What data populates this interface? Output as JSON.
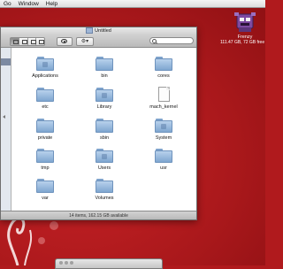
{
  "menubar": {
    "items": [
      "Go",
      "Window",
      "Help"
    ]
  },
  "desktop": {
    "drive": {
      "name": "Frenzy",
      "free": "111.47 GB, 72 GB free"
    }
  },
  "window": {
    "title": "Untitled",
    "status": "14 items, 162.15 GB available",
    "items": [
      {
        "name": "Applications",
        "kind": "folder"
      },
      {
        "name": "bin",
        "kind": "folder"
      },
      {
        "name": "cores",
        "kind": "folder"
      },
      {
        "name": "etc",
        "kind": "folder"
      },
      {
        "name": "Library",
        "kind": "folder"
      },
      {
        "name": "mach_kernel",
        "kind": "document"
      },
      {
        "name": "private",
        "kind": "folder"
      },
      {
        "name": "sbin",
        "kind": "folder"
      },
      {
        "name": "System",
        "kind": "folder"
      },
      {
        "name": "tmp",
        "kind": "folder"
      },
      {
        "name": "Users",
        "kind": "folder"
      },
      {
        "name": "usr",
        "kind": "folder"
      },
      {
        "name": "var",
        "kind": "folder"
      },
      {
        "name": "Volumes",
        "kind": "folder"
      }
    ]
  },
  "colors": {
    "desktop": "#b01a1d",
    "folder": "#9dbfe3",
    "sidebar_selection": "#7c8aa2"
  },
  "icons": {
    "view_buttons": [
      "icon-view-icon",
      "list-view-icon",
      "column-view-icon",
      "coverflow-view-icon"
    ],
    "quicklook": "eye-icon",
    "action": "gear-icon",
    "search": "search-icon"
  }
}
